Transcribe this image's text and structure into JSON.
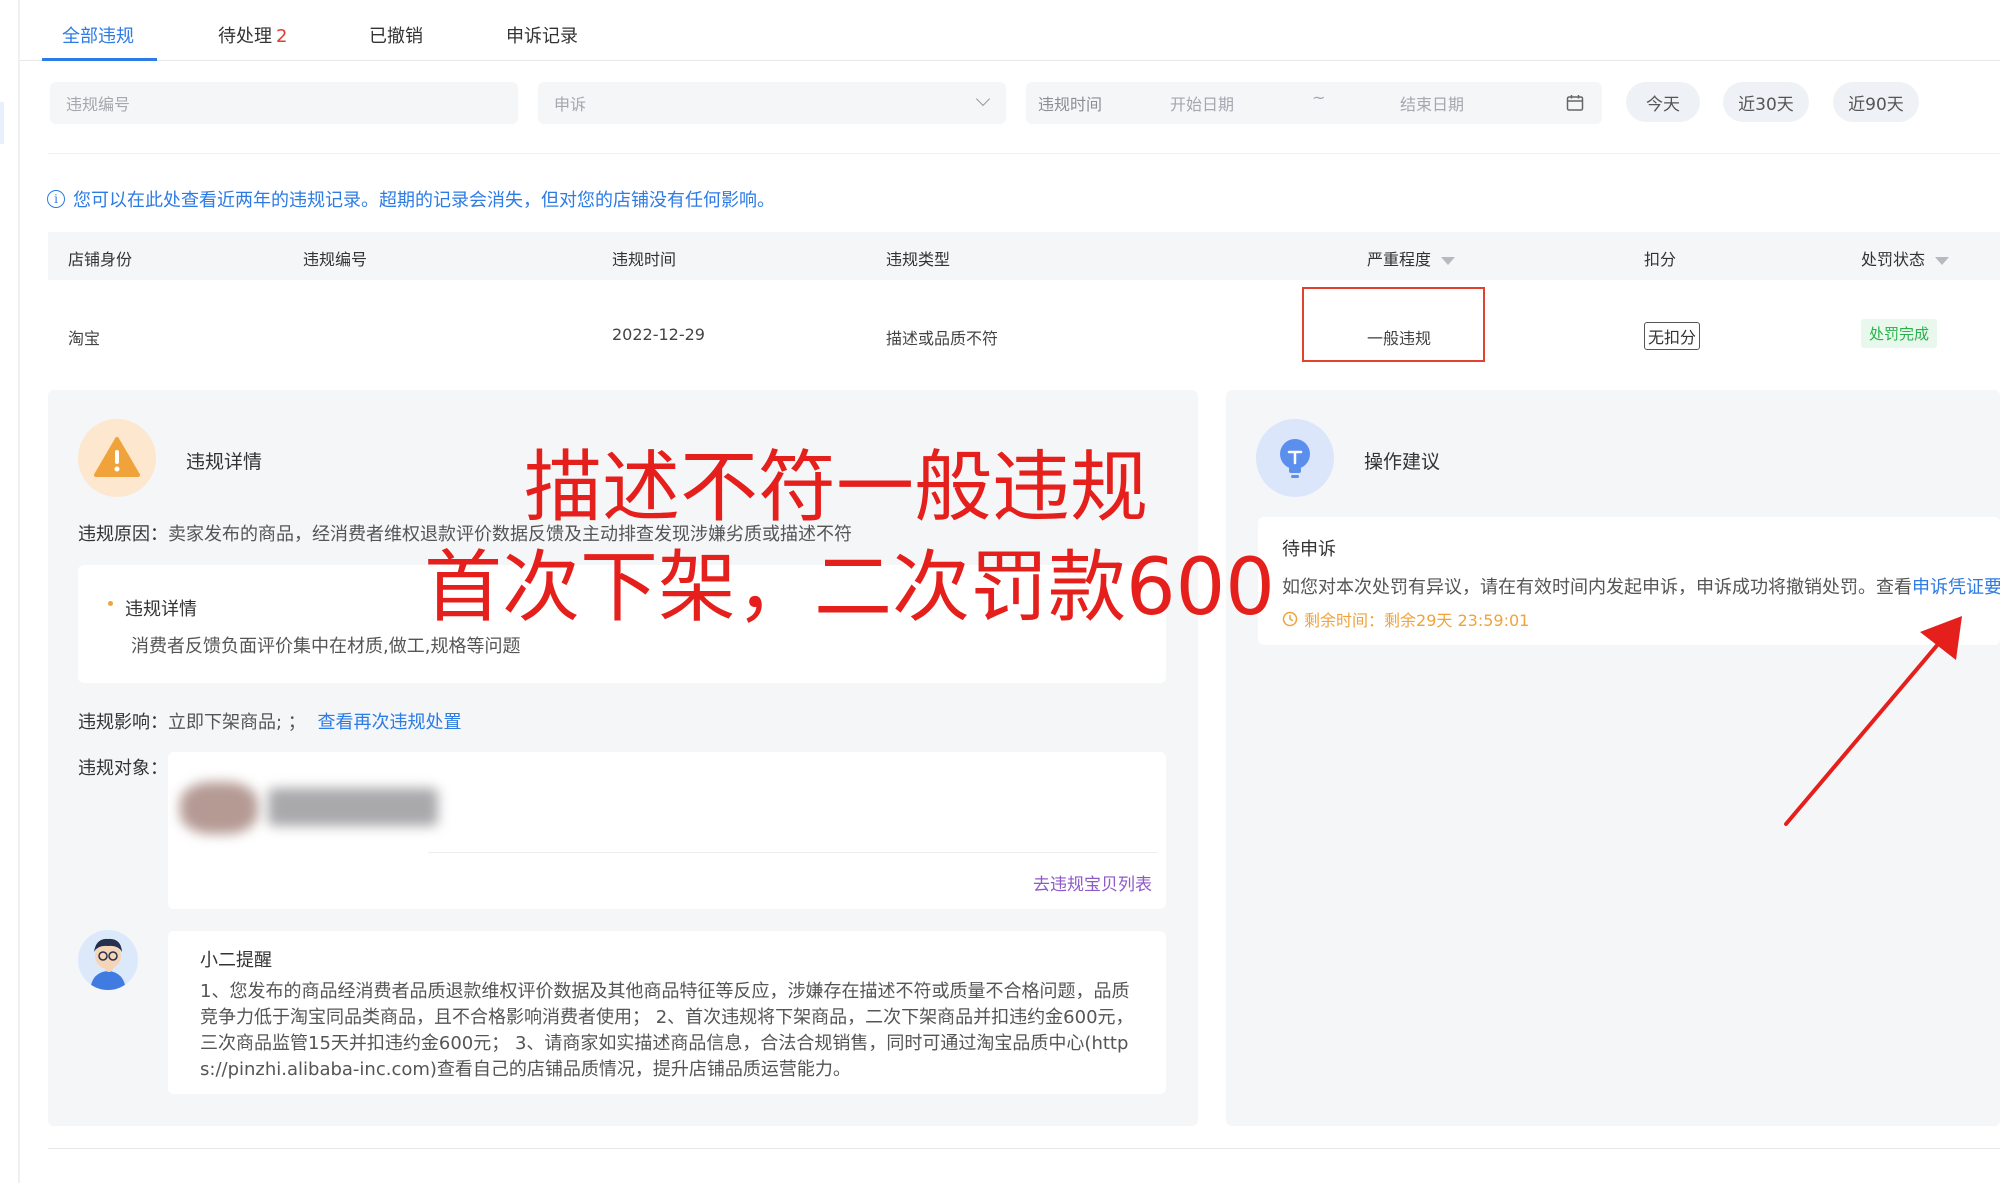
{
  "tabs": {
    "all": "全部违规",
    "pending": "待处理",
    "pending_count": "2",
    "revoked": "已撤销",
    "appeals": "申诉记录"
  },
  "filters": {
    "id_placeholder": "违规编号",
    "appeal_select": "申诉",
    "time_label": "违规时间",
    "start_placeholder": "开始日期",
    "range_sep": "~",
    "end_placeholder": "结束日期",
    "today": "今天",
    "last30": "近30天",
    "last90": "近90天"
  },
  "notice": "您可以在此处查看近两年的违规记录。超期的记录会消失，但对您的店铺没有任何影响。",
  "table": {
    "headers": [
      "店铺身份",
      "违规编号",
      "违规时间",
      "违规类型",
      "严重程度",
      "扣分",
      "处罚状态"
    ],
    "row": {
      "shop": "淘宝",
      "id": "",
      "time": "2022-12-29",
      "type": "描述或品质不符",
      "severity": "一般违规",
      "score": "无扣分",
      "status": "处罚完成"
    }
  },
  "detail": {
    "title": "违规详情",
    "reason_label": "违规原因：",
    "reason": "卖家发布的商品，经消费者维权退款评价数据反馈及主动排查发现涉嫌劣质或描述不符",
    "sub_title": "违规详情",
    "sub_text": "消费者反馈负面评价集中在材质,做工,规格等问题",
    "impact_label": "违规影响：",
    "impact": "立即下架商品; ；",
    "impact_link": "查看再次违规处置",
    "object_label": "违规对象：",
    "object_link": "去违规宝贝列表",
    "tip_title": "小二提醒",
    "tip_lines": [
      "1、您发布的商品经消费者品质退款维权评价数据及其他商品特征等反应，涉嫌存在描述不符或质量不合格问题，品质",
      "竞争力低于淘宝同品类商品，且不合格影响消费者使用； 2、首次违规将下架商品，二次下架商品并扣违约金600元，",
      "三次商品监管15天并扣违约金600元； 3、请商家如实描述商品信息，合法合规销售，同时可通过淘宝品质中心(http",
      "s://pinzhi.alibaba-inc.com)查看自己的店铺品质情况，提升店铺品质运营能力。"
    ]
  },
  "advice": {
    "title": "操作建议",
    "status": "待申诉",
    "text": "如您对本次处罚有异议，请在有效时间内发起申诉，申诉成功将撤销处罚。查看",
    "link": "申诉凭证要",
    "remain_label": "剩余时间：",
    "remain_value": "剩余29天 23:59:01"
  },
  "annotation": {
    "line1": "描述不符一般违规",
    "line2": "首次下架，二次罚款600"
  },
  "colors": {
    "accent": "#2d7be5",
    "warning": "#f0a33a",
    "danger": "#e5201c",
    "success": "#27b24a"
  }
}
